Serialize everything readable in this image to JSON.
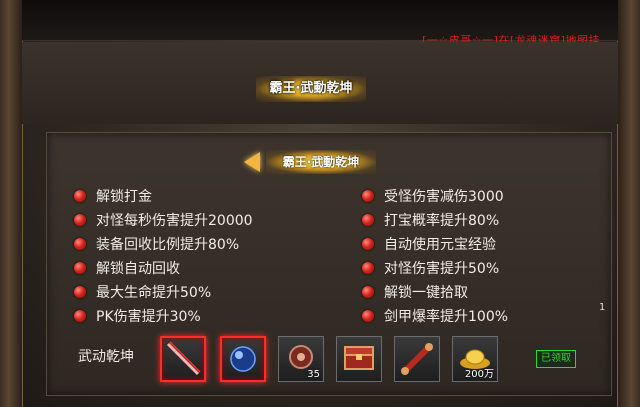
{
  "notice": "[一☆皮哥☆一]在[龙魂迷窟]地图挂",
  "title": "霸王·武動乾坤",
  "subtitle": "霸王·武動乾坤",
  "perks_left": [
    "解锁打金",
    "对怪每秒伤害提升20000",
    "装备回收比例提升80%",
    "解锁自动回收",
    "最大生命提升50%",
    "PK伤害提升30%"
  ],
  "perks_right": [
    "受怪伤害减伤3000",
    "打宝概率提升80%",
    "自动使用元宝经验",
    "对怪伤害提升50%",
    "解锁一键拾取",
    "剑甲爆率提升100%"
  ],
  "page_number": "1",
  "reward_label": "武动乾坤",
  "rewards": [
    {
      "icon": "sword-icon",
      "qty": ""
    },
    {
      "icon": "orb-icon",
      "qty": ""
    },
    {
      "icon": "armor-icon",
      "qty": "35"
    },
    {
      "icon": "chest-icon",
      "qty": ""
    },
    {
      "icon": "scroll-icon",
      "qty": ""
    },
    {
      "icon": "gold-ingot-icon",
      "qty": "200万"
    }
  ],
  "claimed_label": "已领取",
  "colors": {
    "accent_gold": "#f2b640",
    "highlight_red": "#ff2a2a",
    "claimed_green": "#2dd82d"
  }
}
